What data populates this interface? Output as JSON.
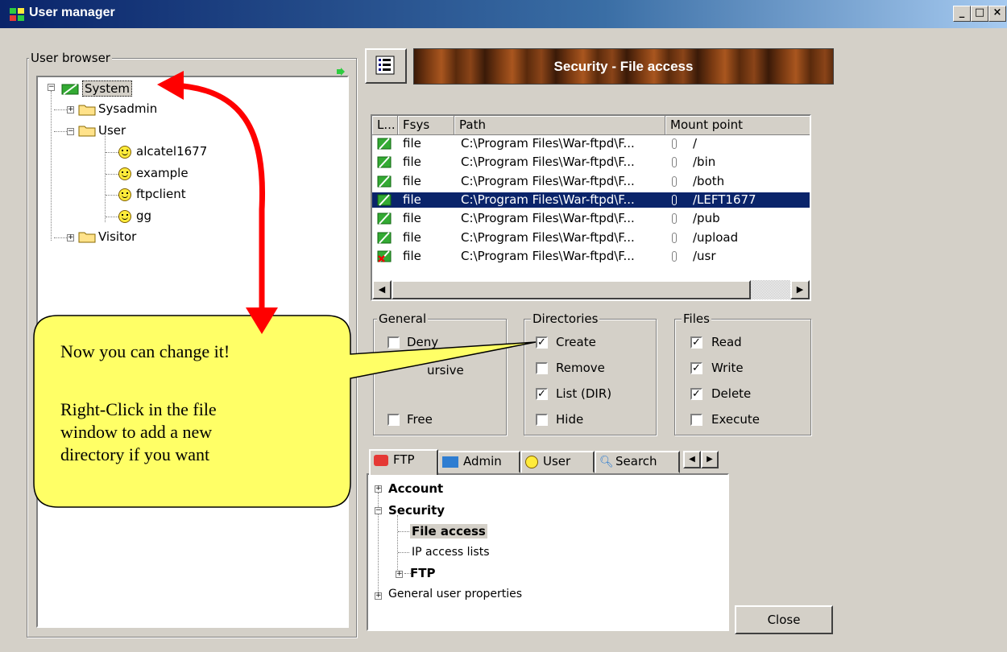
{
  "window": {
    "title": "User manager"
  },
  "user_browser": {
    "label": "User browser",
    "tree": [
      {
        "label": "System"
      },
      {
        "label": "Sysadmin"
      },
      {
        "label": "User"
      },
      {
        "label": "alcatel1677"
      },
      {
        "label": "example"
      },
      {
        "label": "ftpclient"
      },
      {
        "label": "gg"
      },
      {
        "label": "Visitor"
      }
    ]
  },
  "header": {
    "title": "Security - File access"
  },
  "file_table": {
    "columns": [
      "L...",
      "Fsys",
      "Path",
      "Mount point"
    ],
    "rows": [
      {
        "fsys": "file",
        "path": "C:\\Program Files\\War-ftpd\\F...",
        "mount": "/",
        "status": "ok"
      },
      {
        "fsys": "file",
        "path": "C:\\Program Files\\War-ftpd\\F...",
        "mount": "/bin",
        "status": "ok"
      },
      {
        "fsys": "file",
        "path": "C:\\Program Files\\War-ftpd\\F...",
        "mount": "/both",
        "status": "ok"
      },
      {
        "fsys": "file",
        "path": "C:\\Program Files\\War-ftpd\\F...",
        "mount": "/LEFT1677",
        "status": "ok",
        "selected": true
      },
      {
        "fsys": "file",
        "path": "C:\\Program Files\\War-ftpd\\F...",
        "mount": "/pub",
        "status": "ok"
      },
      {
        "fsys": "file",
        "path": "C:\\Program Files\\War-ftpd\\F...",
        "mount": "/upload",
        "status": "ok"
      },
      {
        "fsys": "file",
        "path": "C:\\Program Files\\War-ftpd\\F...",
        "mount": "/usr",
        "status": "denied"
      }
    ]
  },
  "general": {
    "label": "General",
    "deny": "Deny",
    "recursive_partial": "ursive",
    "free": "Free"
  },
  "directories": {
    "label": "Directories",
    "create": "Create",
    "remove": "Remove",
    "list": "List (DIR)",
    "hide": "Hide",
    "checked": {
      "create": true,
      "remove": false,
      "list": true,
      "hide": false
    }
  },
  "files": {
    "label": "Files",
    "read": "Read",
    "write": "Write",
    "delete": "Delete",
    "execute": "Execute",
    "checked": {
      "read": true,
      "write": true,
      "delete": true,
      "execute": false
    }
  },
  "tabs": [
    {
      "label": "FTP"
    },
    {
      "label": "Admin"
    },
    {
      "label": "User"
    },
    {
      "label": "Search"
    }
  ],
  "settings_tree": {
    "account": "Account",
    "security": "Security",
    "file_access": "File access",
    "ip_access": "IP access lists",
    "ftp": "FTP",
    "general_props": "General user properties"
  },
  "close_label": "Close",
  "callout": {
    "line1": "Now you can change it!",
    "line2": "Right-Click in the file",
    "line3": "window to add a new",
    "line4": "directory if you want"
  },
  "colors": {
    "title_bar": "#0a246a",
    "selection": "#0a246a",
    "callout_fill": "#ffff66",
    "arrow": "#ff0000"
  }
}
